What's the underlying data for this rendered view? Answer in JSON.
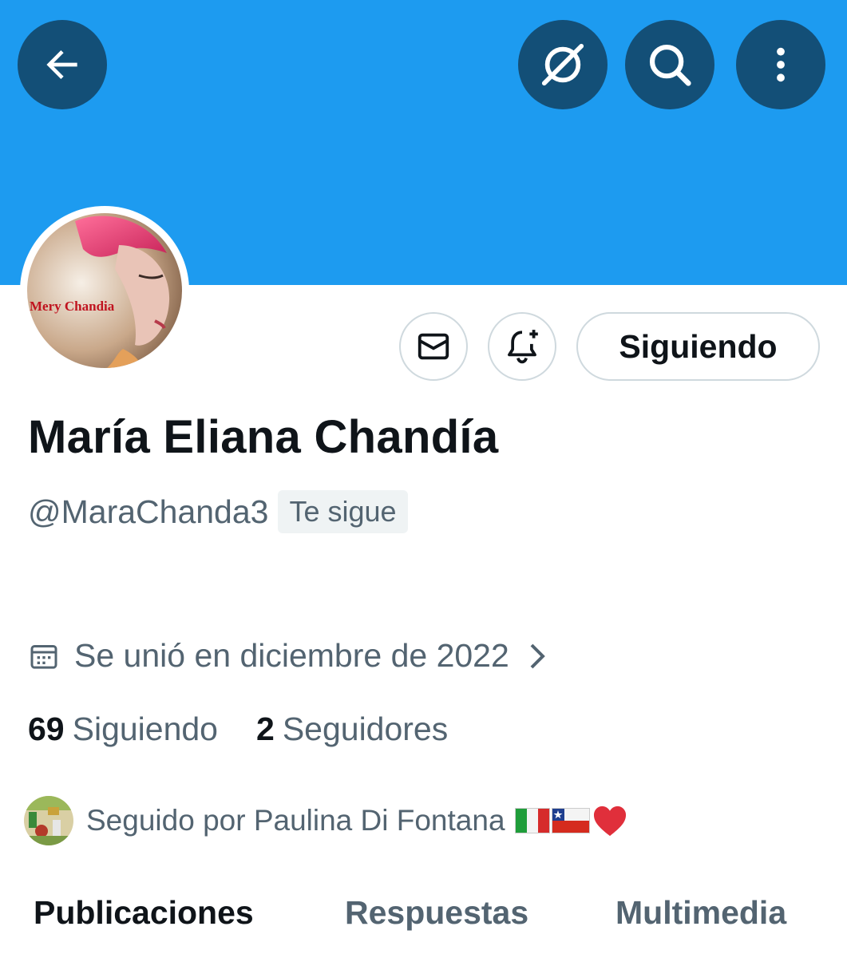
{
  "header": {
    "back_icon": "arrow-left-icon",
    "grok_icon": "grok-icon",
    "search_icon": "search-icon",
    "more_icon": "more-vertical-icon",
    "banner_color": "#1d9bf0"
  },
  "profile": {
    "avatar_text": "Mery Chandia",
    "name": "María Eliana Chandía",
    "handle": "@MaraChanda3",
    "follows_you_badge": "Te sigue",
    "follow_button_label": "Siguiendo",
    "message_icon": "envelope-icon",
    "notify_icon": "bell-plus-icon",
    "joined_icon": "calendar-icon",
    "joined_text": "Se unió en diciembre de 2022",
    "following_count": "69",
    "following_label": "Siguiendo",
    "followers_count": "2",
    "followers_label": "Seguidores",
    "followed_by_text": "Seguido por Paulina Di Fontana",
    "followed_by_emojis": [
      "italy-flag",
      "chile-flag",
      "red-heart"
    ]
  },
  "tabs": [
    {
      "label": "Publicaciones",
      "active": true
    },
    {
      "label": "Respuestas",
      "active": false
    },
    {
      "label": "Multimedia",
      "active": false
    }
  ]
}
